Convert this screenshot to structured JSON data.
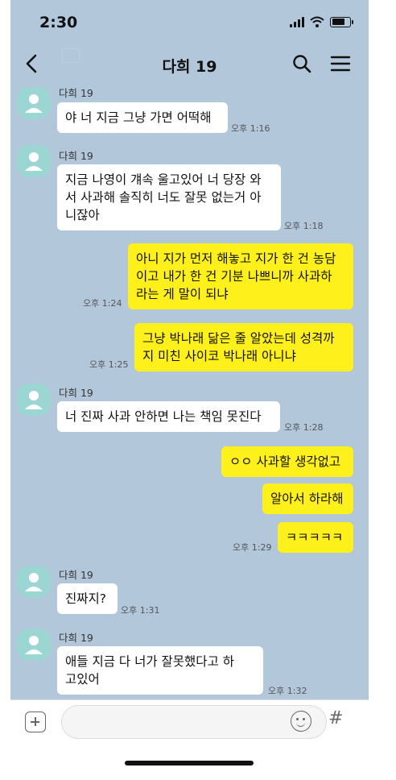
{
  "status_bar": {
    "time": "2:30"
  },
  "header": {
    "title": "다희 19"
  },
  "messages": [
    {
      "sender": "다희 19",
      "text": "야 너 지금 그냥 가면 어떡해",
      "time": "오후 1:16"
    },
    {
      "sender": "다희 19",
      "text": "지금 나영이 걔속 울고있어 너 당장 와\n서 사과해 솔직히 너도 잘못 없는거 아\n니잖아",
      "time": "오후 1:18"
    },
    {
      "text": "아니 지가 먼저 해놓고 지가 한 건 농담\n이고 내가 한 건 기분 나쁘니까 사과하\n라는 게 말이 되냐",
      "time": "오후 1:24"
    },
    {
      "text": "그냥 박나래 닮은 줄 알았는데 성격까\n지 미친 사이코 박나래 아니냐",
      "time": "오후 1:25"
    },
    {
      "sender": "다희 19",
      "text": "너 진짜 사과 안하면 나는 책임 못진다",
      "time": "오후 1:28"
    },
    {
      "text": "ㅇㅇ 사과할 생각없고"
    },
    {
      "text": "알아서 하라해"
    },
    {
      "text": "ㅋㅋㅋㅋㅋ",
      "time": "오후 1:29"
    },
    {
      "sender": "다희 19",
      "text": "진짜지?",
      "time": "오후 1:31"
    },
    {
      "sender": "다희 19",
      "text": "애들 지금 다 너가 잘못했다고 하\n고있어",
      "time": "오후 1:32"
    }
  ],
  "input": {
    "value": ""
  },
  "icons": {
    "back": "chevron-left-icon",
    "search": "search-icon",
    "menu": "menu-icon",
    "plus": "plus-icon",
    "emoji": "emoji-icon",
    "hash": "#"
  },
  "colors": {
    "chat_background": "#b2c7da",
    "my_bubble": "#fef01b",
    "their_bubble": "#ffffff",
    "avatar": "#9bd6d2"
  }
}
